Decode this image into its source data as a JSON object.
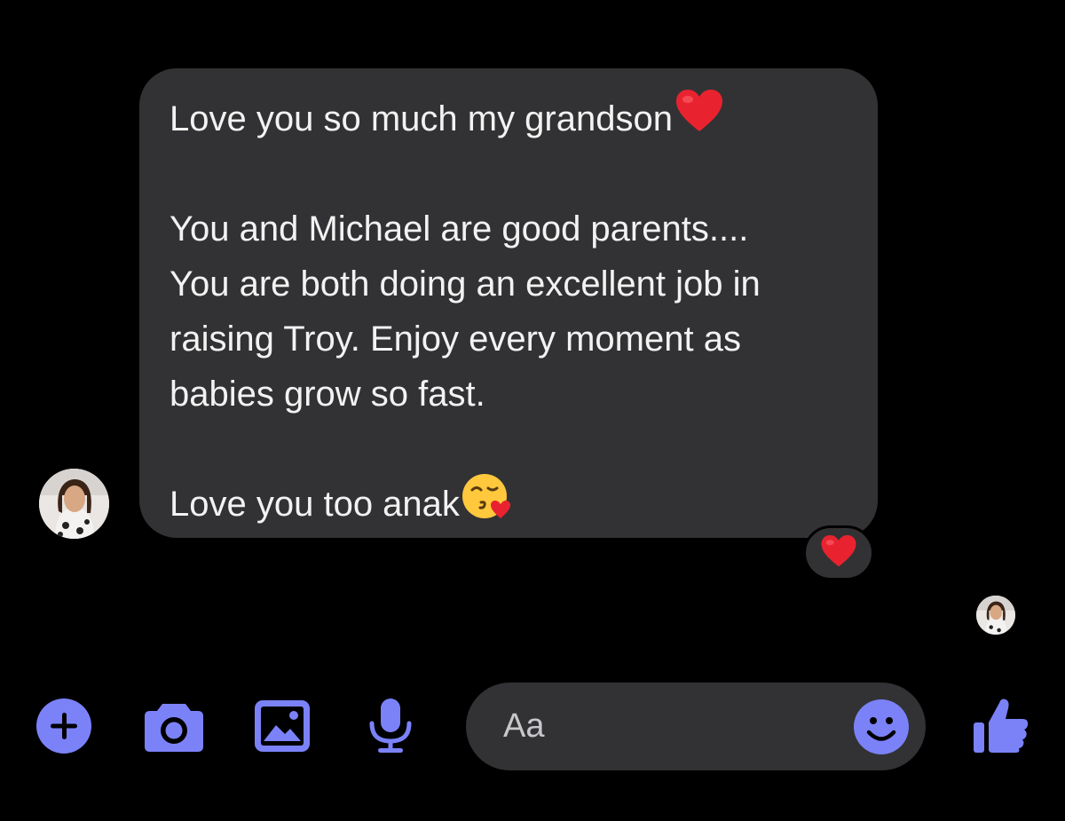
{
  "message": {
    "lines": [
      "Love you so much my grandson",
      "",
      "You and Michael are good parents....",
      "You are both doing an excellent job in",
      "raising Troy. Enjoy every moment as",
      "babies grow so fast.",
      "",
      "Love you too anak"
    ],
    "line1_emoji": "red-heart-emoji",
    "last_line_emoji": "face-blowing-kiss-emoji",
    "reaction": "red-heart-emoji"
  },
  "composer": {
    "placeholder": "Aa",
    "icons": [
      "plus-icon",
      "camera-icon",
      "image-icon",
      "microphone-icon",
      "emoji-icon",
      "thumbs-up-icon"
    ]
  },
  "colors": {
    "background": "#000000",
    "bubble": "#323234",
    "accent": "#7b82f8",
    "heart": "#e8232f"
  }
}
